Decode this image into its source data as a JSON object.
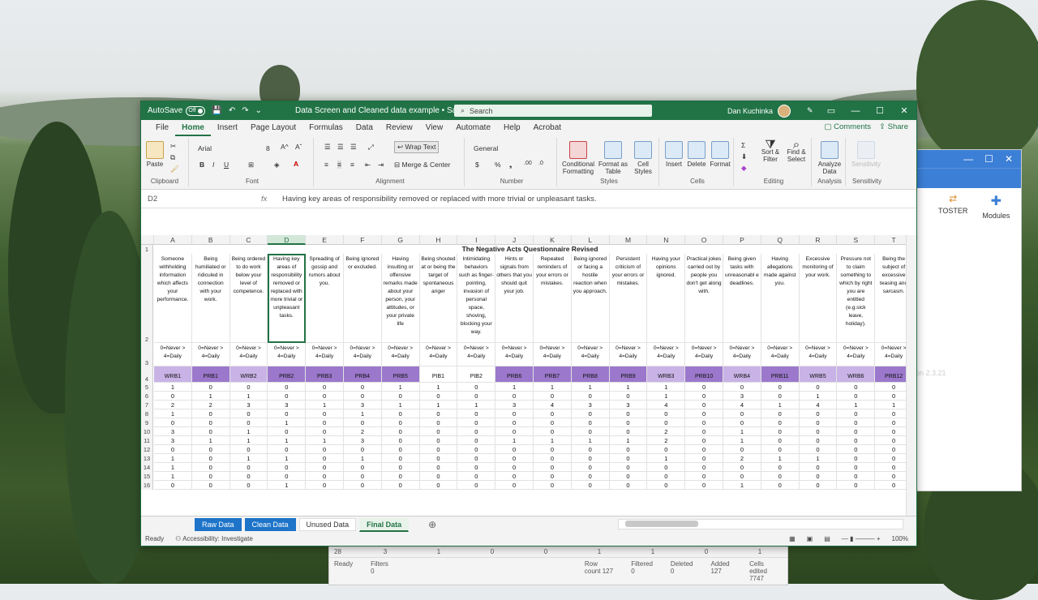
{
  "excel": {
    "autosave_label": "AutoSave",
    "autosave_state": "Off",
    "doc_title": "Data Screen and Cleaned data example • Saved",
    "search_placeholder": "Search",
    "user_name": "Dan Kuchinka",
    "menu": [
      "File",
      "Home",
      "Insert",
      "Page Layout",
      "Formulas",
      "Data",
      "Review",
      "View",
      "Automate",
      "Help",
      "Acrobat"
    ],
    "active_menu": "Home",
    "comments_label": "Comments",
    "share_label": "Share",
    "ribbon": {
      "paste": "Paste",
      "font_name": "Arial",
      "font_size": "8",
      "wrap_text": "Wrap Text",
      "merge_center": "Merge & Center",
      "number_format": "General",
      "conditional_formatting": "Conditional Formatting",
      "format_as_table": "Format as Table",
      "cell_styles": "Cell Styles",
      "insert": "Insert",
      "delete": "Delete",
      "format": "Format",
      "sort_filter": "Sort & Filter",
      "find_select": "Find & Select",
      "analyze_data": "Analyze Data",
      "sensitivity": "Sensitivity",
      "groups": [
        "Clipboard",
        "Font",
        "Alignment",
        "Number",
        "Styles",
        "Cells",
        "Editing",
        "Analysis",
        "Sensitivity"
      ]
    },
    "name_box": "D2",
    "formula_text": "Having key areas of responsibility removed or replaced with more trivial or unpleasant tasks.",
    "columns": [
      "A",
      "B",
      "C",
      "D",
      "E",
      "F",
      "G",
      "H",
      "I",
      "J",
      "K",
      "L",
      "M",
      "N",
      "O",
      "P",
      "Q",
      "R",
      "S",
      "T"
    ],
    "sheet_title": "The Negative Acts Questionnaire Revised",
    "questions": [
      "Someone withholding information which affects your performance.",
      "Being humiliated or ridiculed in connection with your work.",
      "Being ordered to do work below your level of competence.",
      "Having key areas of responsibility removed or replaced with more trivial or unpleasant tasks.",
      "Spreading of gossip and rumors about you.",
      "Being ignored or excluded.",
      "Having insulting or offensive remarks made about your person, your attitudes, or your private life",
      "Being shouted at or being the target of spontaneous anger",
      "Intimidating behaviors such as finger-pointing, invasion of personal space, shoving, blocking your way.",
      "Hints or signals from others that you should quit your job.",
      "Repeated reminders of your errors or mistakes.",
      "Being ignored or facing a hostile reaction when you approach.",
      "Persistent criticism of your errors or mistakes.",
      "Having your opinions ignored.",
      "Practical jokes carried out by people you don't get along with.",
      "Being given tasks with unreasonabl e deadlines.",
      "Having allegations made against you.",
      "Excessive monitoring of your work.",
      "Pressure not to claim something to which by right you are entitled (e.g.sick leave, holiday).",
      "Being the subject of excessive teasing and sarcasm."
    ],
    "scale_label": "0=Never > 4=Daily",
    "codes": [
      "WRB1",
      "PRB1",
      "WRB2",
      "PRB2",
      "PRB3",
      "PRB4",
      "PRB5",
      "PIB1",
      "PIB2",
      "PRB6",
      "PRB7",
      "PRB8",
      "PRB9",
      "WRB3",
      "PRB10",
      "WRB4",
      "PRB11",
      "WRB5",
      "WRB6",
      "PRB12"
    ],
    "code_colors": {
      "WRB": "#c9b3e6",
      "PRB": "#9b78cc",
      "PIB": "#ffffff"
    },
    "row_numbers": [
      "1",
      "2",
      "3",
      "4",
      "5",
      "6",
      "7",
      "8",
      "9",
      "10",
      "11",
      "12",
      "13",
      "14",
      "15",
      "16"
    ],
    "data_rows": [
      [
        "1",
        "0",
        "0",
        "0",
        "0",
        "0",
        "1",
        "1",
        "0",
        "1",
        "1",
        "1",
        "1",
        "1",
        "0",
        "0",
        "0",
        "0",
        "0",
        "0"
      ],
      [
        "0",
        "1",
        "1",
        "0",
        "0",
        "0",
        "0",
        "0",
        "0",
        "0",
        "0",
        "0",
        "0",
        "1",
        "0",
        "3",
        "0",
        "1",
        "0",
        "0"
      ],
      [
        "2",
        "2",
        "3",
        "3",
        "1",
        "3",
        "1",
        "1",
        "1",
        "3",
        "4",
        "3",
        "3",
        "4",
        "0",
        "4",
        "1",
        "4",
        "1",
        "1"
      ],
      [
        "1",
        "0",
        "0",
        "0",
        "0",
        "1",
        "0",
        "0",
        "0",
        "0",
        "0",
        "0",
        "0",
        "0",
        "0",
        "0",
        "0",
        "0",
        "0",
        "0"
      ],
      [
        "0",
        "0",
        "0",
        "1",
        "0",
        "0",
        "0",
        "0",
        "0",
        "0",
        "0",
        "0",
        "0",
        "0",
        "0",
        "0",
        "0",
        "0",
        "0",
        "0"
      ],
      [
        "3",
        "0",
        "1",
        "0",
        "0",
        "2",
        "0",
        "0",
        "0",
        "0",
        "0",
        "0",
        "0",
        "2",
        "0",
        "1",
        "0",
        "0",
        "0",
        "0"
      ],
      [
        "3",
        "1",
        "1",
        "1",
        "1",
        "3",
        "0",
        "0",
        "0",
        "1",
        "1",
        "1",
        "1",
        "2",
        "0",
        "1",
        "0",
        "0",
        "0",
        "0"
      ],
      [
        "0",
        "0",
        "0",
        "0",
        "0",
        "0",
        "0",
        "0",
        "0",
        "0",
        "0",
        "0",
        "0",
        "0",
        "0",
        "0",
        "0",
        "0",
        "0",
        "0"
      ],
      [
        "1",
        "0",
        "1",
        "1",
        "0",
        "1",
        "0",
        "0",
        "0",
        "0",
        "0",
        "0",
        "0",
        "1",
        "0",
        "2",
        "1",
        "1",
        "0",
        "0"
      ],
      [
        "1",
        "0",
        "0",
        "0",
        "0",
        "0",
        "0",
        "0",
        "0",
        "0",
        "0",
        "0",
        "0",
        "0",
        "0",
        "0",
        "0",
        "0",
        "0",
        "0"
      ],
      [
        "1",
        "0",
        "0",
        "0",
        "0",
        "0",
        "0",
        "0",
        "0",
        "0",
        "0",
        "0",
        "0",
        "0",
        "0",
        "0",
        "0",
        "0",
        "0",
        "0"
      ],
      [
        "0",
        "0",
        "0",
        "1",
        "0",
        "0",
        "0",
        "0",
        "0",
        "0",
        "0",
        "0",
        "0",
        "0",
        "0",
        "1",
        "0",
        "0",
        "0",
        "0"
      ]
    ],
    "sheets": [
      "Raw Data",
      "Clean Data",
      "Unused Data",
      "Final Data"
    ],
    "active_sheet": "Final Data",
    "status_ready": "Ready",
    "accessibility": "Accessibility: Investigate",
    "zoom": "100%"
  },
  "background_app": {
    "tool1": "TOSTER",
    "tool2": "Modules",
    "side_label": "at",
    "faded_text": "on 2.3.21",
    "row_label": "28",
    "row_values": [
      "3",
      "1",
      "0",
      "0",
      "1",
      "1",
      "0",
      "1"
    ],
    "status": [
      "Ready",
      "Filters 0",
      "Row count 127",
      "Filtered 0",
      "Deleted 0",
      "Added 127",
      "Cells edited 7747"
    ]
  }
}
